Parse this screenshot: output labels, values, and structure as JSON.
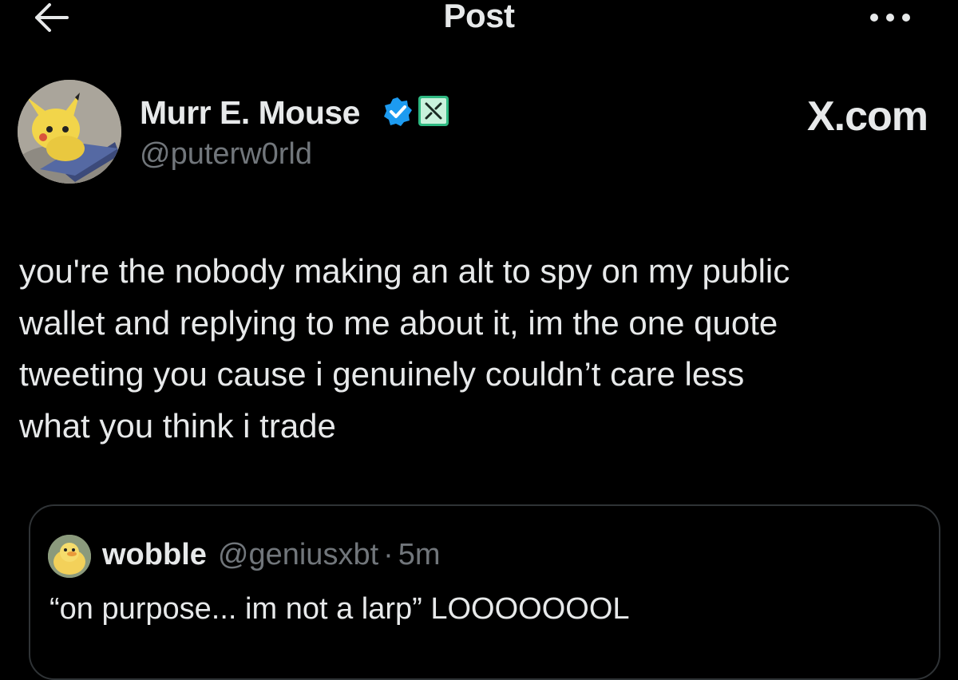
{
  "header": {
    "title": "Post",
    "back_icon": "arrow-left-icon",
    "more_icon": "more-horizontal-icon"
  },
  "post": {
    "author": {
      "name": "Murr E. Mouse",
      "handle": "@puterw0rld",
      "verified": true,
      "verified_icon": "verified-badge-icon",
      "affiliate_icon": "affiliate-badge-icon"
    },
    "watermark": "X.com",
    "text": "you're the nobody making an alt to spy on my public\nwallet and replying to me about it, im the one quote\ntweeting you cause i genuinely couldn’t care less\nwhat you think i trade"
  },
  "quote": {
    "author_name": "wobble",
    "author_handle": "@geniusxbt",
    "separator": "·",
    "time": "5m",
    "text": "“on purpose... im not a larp” LOOOOOOOL"
  },
  "colors": {
    "background": "#000000",
    "text_primary": "#e7e9ea",
    "text_secondary": "#71767b",
    "verified_blue": "#1d9bf0",
    "affiliate_green": "#2fb982",
    "border": "#2f3336"
  }
}
